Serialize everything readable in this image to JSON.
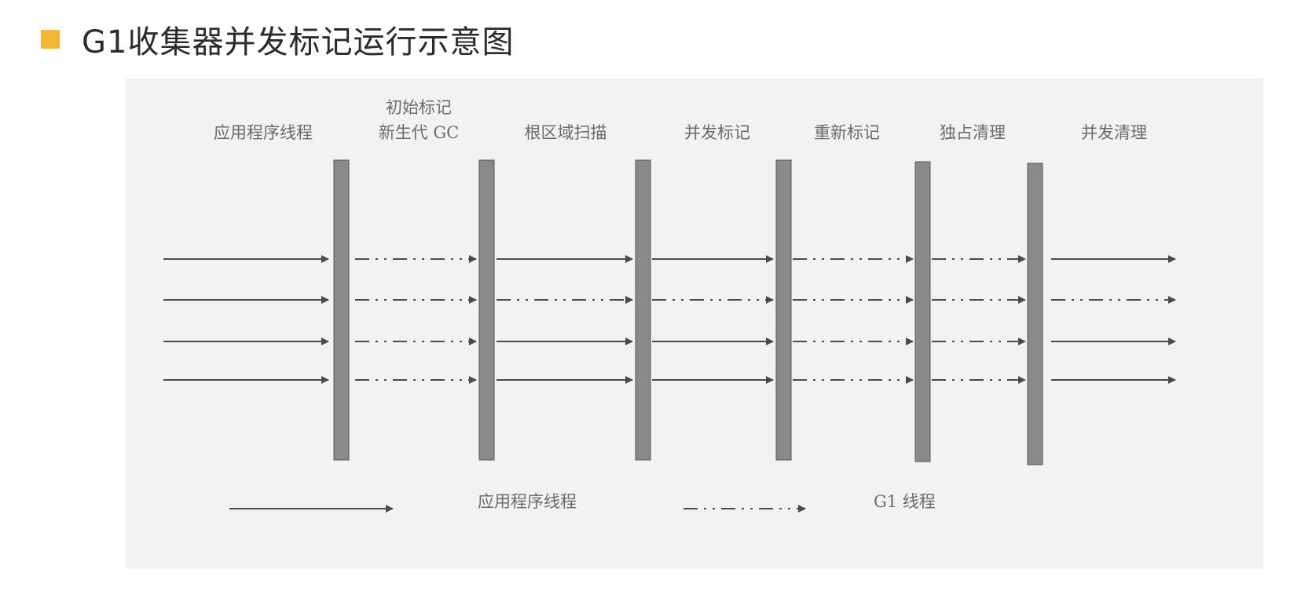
{
  "title": "G1收集器并发标记运行示意图",
  "colors": {
    "accent_square": "#f5b731",
    "figure_background": "#f2f2f2",
    "bar_fill": "#8a8a8a",
    "line": "#4a4a4a",
    "label_text": "#6b6b6b"
  },
  "phases": [
    {
      "id": "app-1",
      "label": [
        "应用程序线程"
      ],
      "threads": [
        "app",
        "app",
        "app",
        "app"
      ]
    },
    {
      "id": "initial-mark",
      "label": [
        "初始标记",
        "新生代 GC"
      ],
      "threads": [
        "g1",
        "g1",
        "g1",
        "g1"
      ]
    },
    {
      "id": "root-region-scan",
      "label": [
        "根区域扫描"
      ],
      "threads": [
        "app",
        "g1",
        "app",
        "app"
      ]
    },
    {
      "id": "concurrent-mark",
      "label": [
        "并发标记"
      ],
      "threads": [
        "app",
        "g1",
        "app",
        "app"
      ]
    },
    {
      "id": "remark",
      "label": [
        "重新标记"
      ],
      "threads": [
        "g1",
        "g1",
        "g1",
        "g1"
      ]
    },
    {
      "id": "exclusive-cleanup",
      "label": [
        "独占清理"
      ],
      "threads": [
        "g1",
        "g1",
        "g1",
        "g1"
      ]
    },
    {
      "id": "concurrent-cleanup",
      "label": [
        "并发清理"
      ],
      "threads": [
        "app",
        "g1",
        "app",
        "app"
      ]
    }
  ],
  "legend": {
    "app_thread_label": "应用程序线程",
    "g1_thread_label": "G1 线程"
  }
}
